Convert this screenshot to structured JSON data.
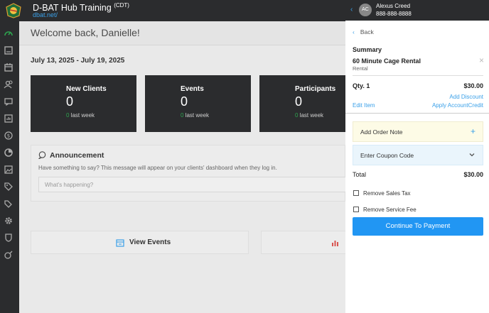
{
  "brand": {
    "title": "D-BAT Hub Training",
    "timezone": "(CDT)",
    "url": "dbat.net/"
  },
  "sidebar": {
    "items": [
      {
        "icon": "dashboard-icon"
      },
      {
        "icon": "book-icon"
      },
      {
        "icon": "calendar-icon"
      },
      {
        "icon": "users-icon"
      },
      {
        "icon": "message-icon"
      },
      {
        "icon": "report-icon"
      },
      {
        "icon": "dollar-icon"
      },
      {
        "icon": "chart-pie-icon"
      },
      {
        "icon": "image-icon"
      },
      {
        "icon": "tag-icon"
      },
      {
        "icon": "tags-icon"
      },
      {
        "icon": "settings-icon"
      },
      {
        "icon": "shield-icon"
      },
      {
        "icon": "launch-icon"
      }
    ]
  },
  "main": {
    "welcome": "Welcome back, Danielle!",
    "date_range": "July 13, 2025 - July 19, 2025",
    "stats": [
      {
        "label": "New Clients",
        "value": "0",
        "last_value": "0",
        "last_label": "last week"
      },
      {
        "label": "Events",
        "value": "0",
        "last_value": "0",
        "last_label": "last week"
      },
      {
        "label": "Participants",
        "value": "0",
        "last_value": "0",
        "last_label": "last week"
      }
    ],
    "announcement": {
      "title": "Announcement",
      "description": "Have something to say? This message will appear on your clients' dashboard when they log in.",
      "placeholder": "What's happening?"
    },
    "view_events_label": "View Events"
  },
  "panel": {
    "client": {
      "initials": "AC",
      "name": "Alexus Creed",
      "phone": "888-888-8888"
    },
    "back_label": "Back",
    "summary_label": "Summary",
    "item": {
      "name": "60 Minute Cage Rental",
      "type": "Rental",
      "qty_label": "Qty. 1",
      "price": "$30.00"
    },
    "add_discount": "Add Discount",
    "edit_item": "Edit Item",
    "apply_credit": "Apply AccountCredit",
    "order_note": "Add Order Note",
    "coupon": "Enter Coupon Code",
    "total_label": "Total",
    "total_amount": "$30.00",
    "remove_tax": "Remove Sales Tax",
    "remove_fee": "Remove Service Fee",
    "pay_button": "Continue To Payment"
  },
  "colors": {
    "dark": "#2b2c2e",
    "accent": "#2196f3",
    "link": "#3aa0e8",
    "green": "#2ea44f"
  }
}
